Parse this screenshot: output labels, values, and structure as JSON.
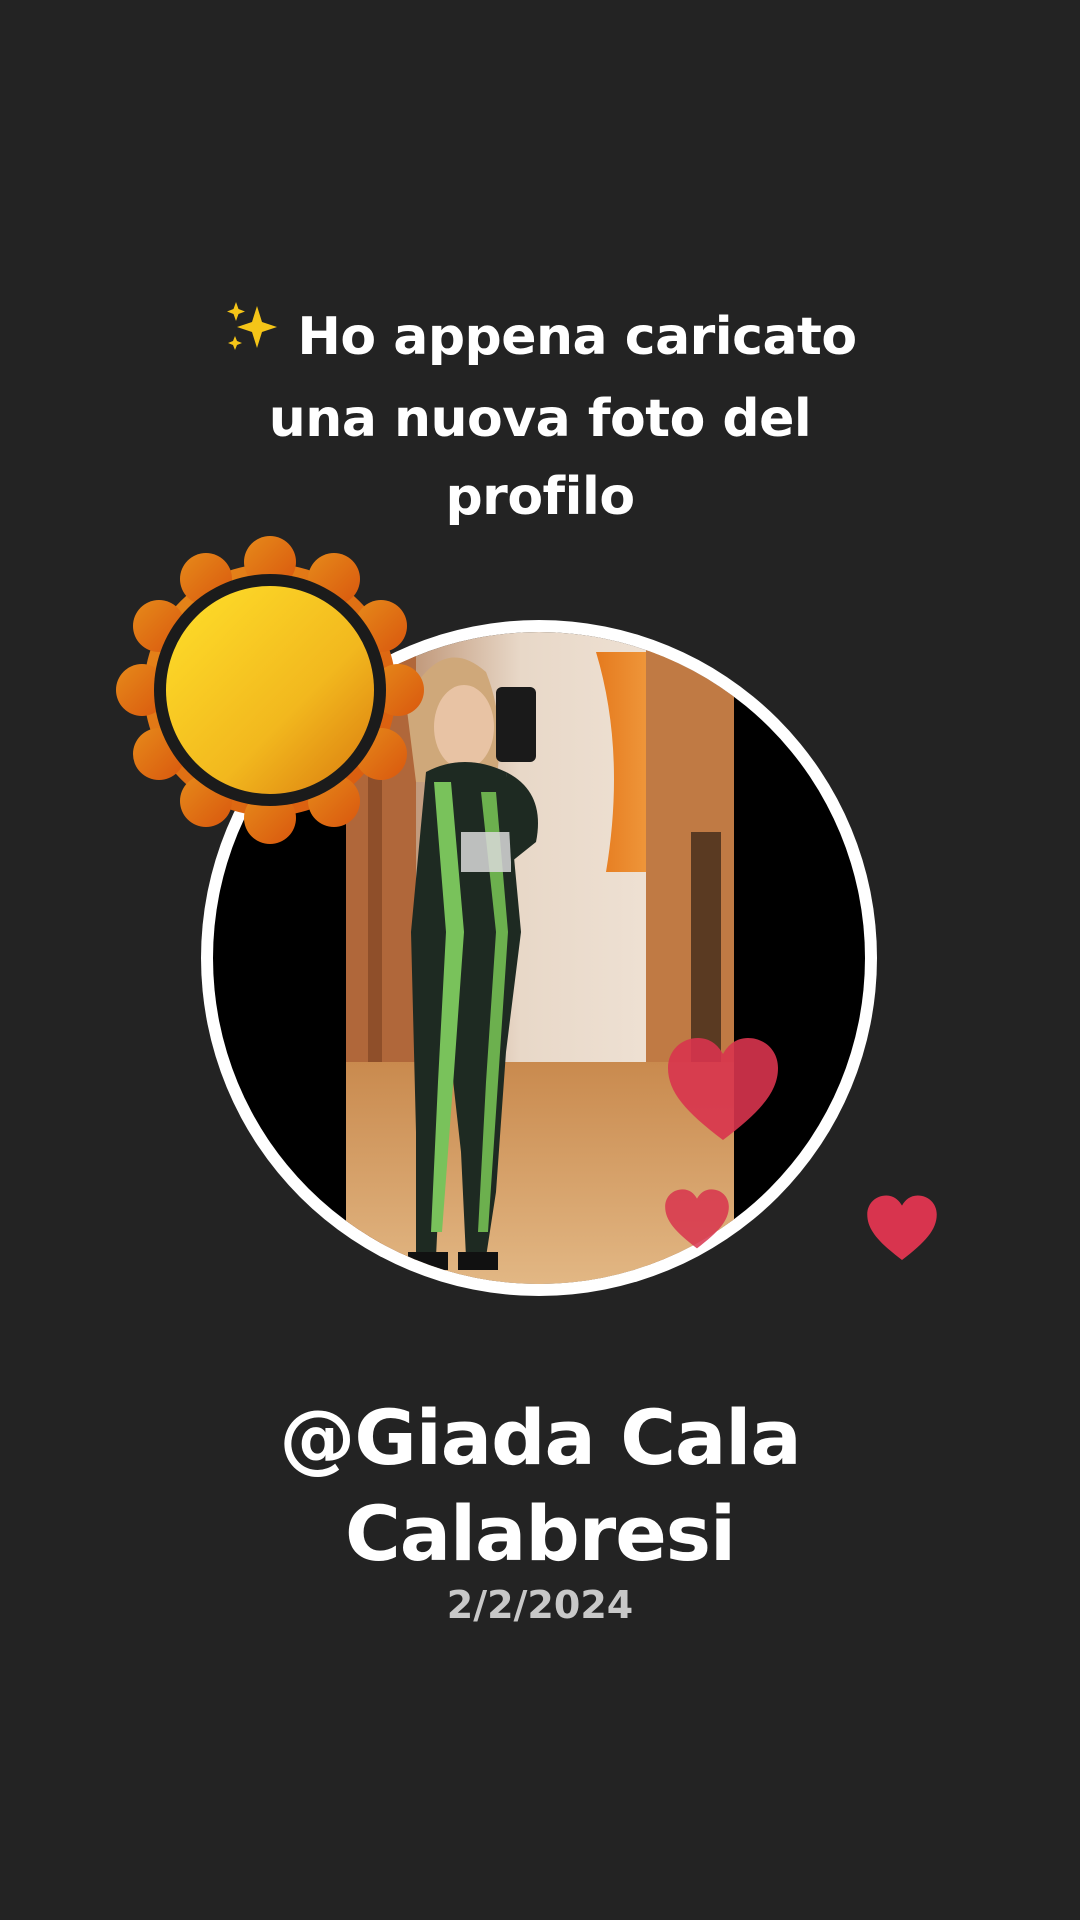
{
  "headline": {
    "emoji_icon": "sparkles-icon",
    "line1": "Ho appena caricato",
    "line2": "una nuova foto del",
    "line3": "profilo"
  },
  "profile": {
    "username": "@Giada Cala Calabresi",
    "date": "2/2/2024"
  },
  "decorations": {
    "sun_icon": "sun-sticker-icon",
    "heart_icon": "heart-sticker-icon",
    "heart_color": "#d8344e"
  },
  "colors": {
    "background": "#232323",
    "text": "#ffffff",
    "date_text": "#c8c8c8",
    "ring": "#ffffff",
    "sun_outer": "#e07b14",
    "sun_inner": "#f6c21c"
  }
}
